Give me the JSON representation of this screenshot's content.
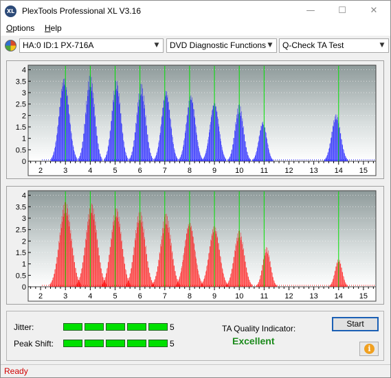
{
  "window": {
    "title": "PlexTools Professional XL V3.16",
    "app_icon_text": "XL",
    "minimize_glyph": "—",
    "maximize_glyph": "☐",
    "close_glyph": "✕"
  },
  "menu": {
    "options_label": "Options",
    "options_accel": "O",
    "options_rest": "ptions",
    "help_accel": "H",
    "help_rest": "elp"
  },
  "toolbar": {
    "device_icon": "plextor-disc-icon",
    "drive": "HA:0 ID:1  PX-716A",
    "function": "DVD Diagnostic Functions",
    "test": "Q-Check TA Test",
    "chevron": "⌵"
  },
  "chart_data": [
    {
      "type": "bar",
      "name": "top",
      "color": "#0000ff",
      "x_ticks": [
        "2",
        "3",
        "4",
        "5",
        "6",
        "7",
        "8",
        "9",
        "10",
        "11",
        "12",
        "13",
        "14",
        "15"
      ],
      "y_ticks": [
        "0",
        "0.5",
        "1",
        "1.5",
        "2",
        "2.5",
        "3",
        "3.5",
        "4"
      ],
      "xlim": [
        1.5,
        15.5
      ],
      "ylim": [
        0,
        4.2
      ],
      "green_markers": [
        3,
        4,
        5,
        6,
        7,
        8,
        9,
        10,
        11,
        14
      ],
      "peaks": [
        {
          "center": 2.95,
          "height": 3.75,
          "halfwidth": 0.42
        },
        {
          "center": 4.0,
          "height": 3.8,
          "halfwidth": 0.38
        },
        {
          "center": 5.05,
          "height": 3.6,
          "halfwidth": 0.38
        },
        {
          "center": 6.05,
          "height": 3.4,
          "halfwidth": 0.38
        },
        {
          "center": 7.05,
          "height": 3.2,
          "halfwidth": 0.38
        },
        {
          "center": 8.05,
          "height": 3.0,
          "halfwidth": 0.38
        },
        {
          "center": 9.0,
          "height": 2.7,
          "halfwidth": 0.38
        },
        {
          "center": 10.0,
          "height": 2.5,
          "halfwidth": 0.36
        },
        {
          "center": 10.95,
          "height": 1.8,
          "halfwidth": 0.33
        },
        {
          "center": 13.9,
          "height": 2.1,
          "halfwidth": 0.38
        }
      ]
    },
    {
      "type": "bar",
      "name": "bottom",
      "color": "#ff0000",
      "x_ticks": [
        "2",
        "3",
        "4",
        "5",
        "6",
        "7",
        "8",
        "9",
        "10",
        "11",
        "12",
        "13",
        "14",
        "15"
      ],
      "y_ticks": [
        "0",
        "0.5",
        "1",
        "1.5",
        "2",
        "2.5",
        "3",
        "3.5",
        "4"
      ],
      "xlim": [
        1.5,
        15.5
      ],
      "ylim": [
        0,
        4.2
      ],
      "green_markers": [
        3,
        4,
        5,
        6,
        7,
        8,
        9,
        10,
        11,
        14
      ],
      "peaks": [
        {
          "center": 3.0,
          "height": 3.75,
          "halfwidth": 0.5
        },
        {
          "center": 4.05,
          "height": 3.7,
          "halfwidth": 0.48
        },
        {
          "center": 5.05,
          "height": 3.5,
          "halfwidth": 0.46
        },
        {
          "center": 6.0,
          "height": 3.35,
          "halfwidth": 0.45
        },
        {
          "center": 7.05,
          "height": 3.2,
          "halfwidth": 0.45
        },
        {
          "center": 8.0,
          "height": 2.95,
          "halfwidth": 0.44
        },
        {
          "center": 9.0,
          "height": 2.75,
          "halfwidth": 0.44
        },
        {
          "center": 10.0,
          "height": 2.5,
          "halfwidth": 0.42
        },
        {
          "center": 11.1,
          "height": 1.75,
          "halfwidth": 0.33
        },
        {
          "center": 14.0,
          "height": 1.25,
          "halfwidth": 0.3
        }
      ]
    }
  ],
  "results": {
    "jitter_label": "Jitter:",
    "jitter_segments": 5,
    "jitter_value": "5",
    "peak_label": "Peak Shift:",
    "peak_segments": 5,
    "peak_value": "5",
    "ta_label": "TA Quality Indicator:",
    "ta_value": "Excellent",
    "start_label": "Start",
    "info_icon": "info-icon",
    "info_glyph": "i",
    "bar_color": "#00e000"
  },
  "status": {
    "text": "Ready"
  }
}
